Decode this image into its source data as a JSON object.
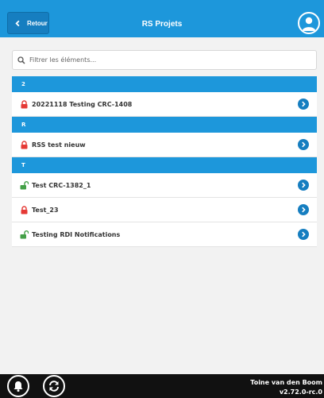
{
  "header": {
    "back_label": "Retour",
    "title": "RS Projets",
    "avatar_icon": "user-icon"
  },
  "search": {
    "placeholder": "Filtrer les éléments...",
    "icon": "search-icon"
  },
  "groups": [
    {
      "letter": "2",
      "items": [
        {
          "label": "20221118 Testing CRC-1408",
          "lock": "locked"
        }
      ]
    },
    {
      "letter": "R",
      "items": [
        {
          "label": "RSS test nieuw",
          "lock": "locked"
        }
      ]
    },
    {
      "letter": "T",
      "items": [
        {
          "label": "Test CRC-1382_1",
          "lock": "unlocked"
        },
        {
          "label": "Test_23",
          "lock": "locked"
        },
        {
          "label": "Testing RDI Notifications",
          "lock": "unlocked"
        }
      ]
    }
  ],
  "footer": {
    "user_name": "Toine van den Boom",
    "version": "v2.72.0-rc.0",
    "notifications_icon": "bell-icon",
    "refresh_icon": "refresh-icon"
  },
  "colors": {
    "accent": "#1d97db",
    "locked": "#e53935",
    "unlocked": "#43a047",
    "footer": "#111111"
  }
}
